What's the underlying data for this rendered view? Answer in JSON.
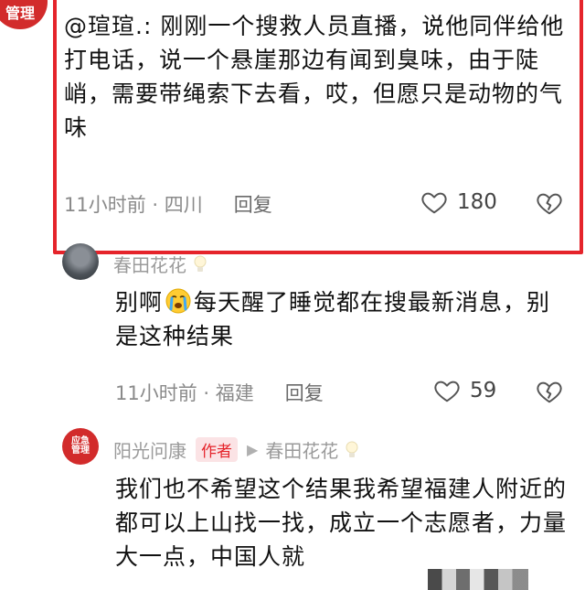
{
  "comments": [
    {
      "author": "瑄瑄.",
      "avatar_label": "管理",
      "text": "@瑄瑄.: 刚刚一个搜救人员直播，说他同伴给他打电话，说一个悬崖那边有闻到臭味，由于陡峭，需要带绳索下去看，哎，但愿只是动物的气味",
      "time_location": "11小时前 · 四川",
      "reply_label": "回复",
      "likes": "180",
      "highlighted": true,
      "highlight_color": "#e5242b"
    },
    {
      "author": "春田花花",
      "text_before_emoji": "别啊",
      "emoji": "crying-face",
      "text_after_emoji": "每天醒了睡觉都在搜最新消息，别是这种结果",
      "time_location": "11小时前 · 福建",
      "reply_label": "回复",
      "likes": "59"
    },
    {
      "author": "阳光问康",
      "avatar_label_top": "应",
      "avatar_label_mid": "急",
      "avatar_label_bottom": "管理",
      "author_badge": "作者",
      "reply_to": "春田花花",
      "text": "我们也不希望这个结果我希望福建人附近的都可以上山找一找，成立一个志愿者，力量大一点，中国人就"
    }
  ],
  "colors": {
    "accent_red": "#e5242b",
    "badge_bg": "#fbe3e5",
    "meta_gray": "#8a8a8a"
  }
}
